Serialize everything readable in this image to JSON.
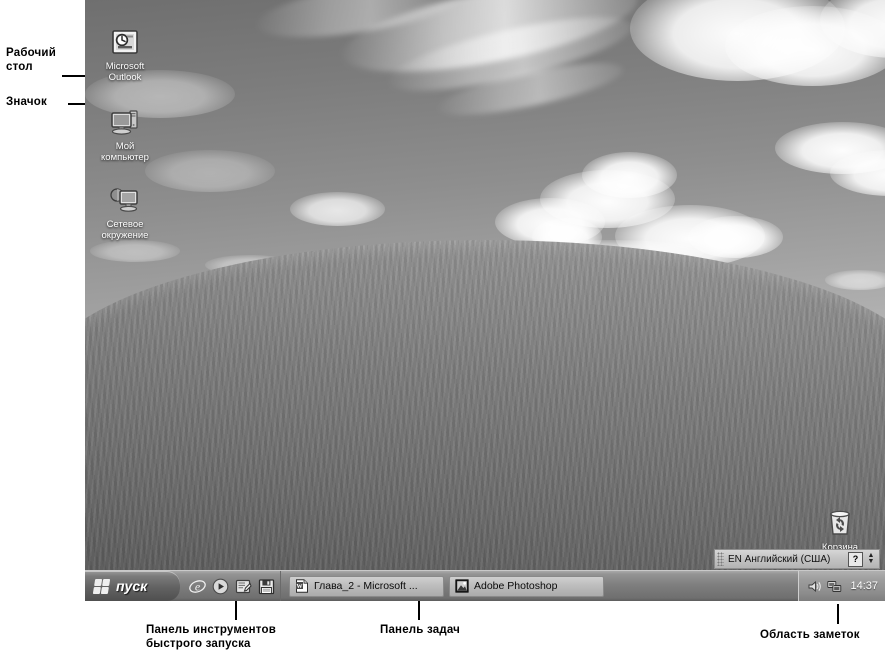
{
  "annotations": [
    {
      "id": "desktop",
      "text": "Рабочий\nстол"
    },
    {
      "id": "icon",
      "text": "Значок"
    },
    {
      "id": "quicklaunch",
      "text": "Панель инструментов\nбыстрого запуска"
    },
    {
      "id": "taskbar",
      "text": "Панель задач"
    },
    {
      "id": "notify",
      "text": "Область заметок"
    }
  ],
  "desktop": {
    "icons": [
      {
        "name": "microsoft-outlook",
        "label": "Microsoft\nOutlook",
        "icon": "outlook-icon"
      },
      {
        "name": "my-computer",
        "label": "Мой\nкомпьютер",
        "icon": "computer-icon"
      },
      {
        "name": "network-places",
        "label": "Сетевое\nокружение",
        "icon": "network-icon"
      },
      {
        "name": "recycle-bin",
        "label": "Корзина",
        "icon": "recycle-bin-icon"
      }
    ]
  },
  "language_bar": {
    "text": "EN Английский (США)",
    "help_label": "?",
    "minimize_label": "▲\n▼"
  },
  "taskbar": {
    "start_label": "пуск",
    "quick_launch": [
      {
        "name": "internet-explorer-icon",
        "title": "Internet Explorer"
      },
      {
        "name": "media-player-icon",
        "title": "Windows Media Player"
      },
      {
        "name": "outlook-express-icon",
        "title": "Outlook Express"
      },
      {
        "name": "save-floppy-icon",
        "title": "Сохранить"
      }
    ],
    "task_buttons": [
      {
        "name": "task-word",
        "label": "Глава_2 - Microsoft ...",
        "icon": "word-document-icon"
      },
      {
        "name": "task-photoshop",
        "label": "Adobe Photoshop",
        "icon": "photoshop-icon"
      }
    ],
    "tray": {
      "icons": [
        {
          "name": "volume-icon"
        },
        {
          "name": "network-connection-icon"
        }
      ],
      "clock": "14:37"
    }
  },
  "colors": {
    "sky": "#8e8e8e",
    "ground": "#6e6e6e",
    "taskbar": "#7f7f7f",
    "text": "#000000"
  }
}
